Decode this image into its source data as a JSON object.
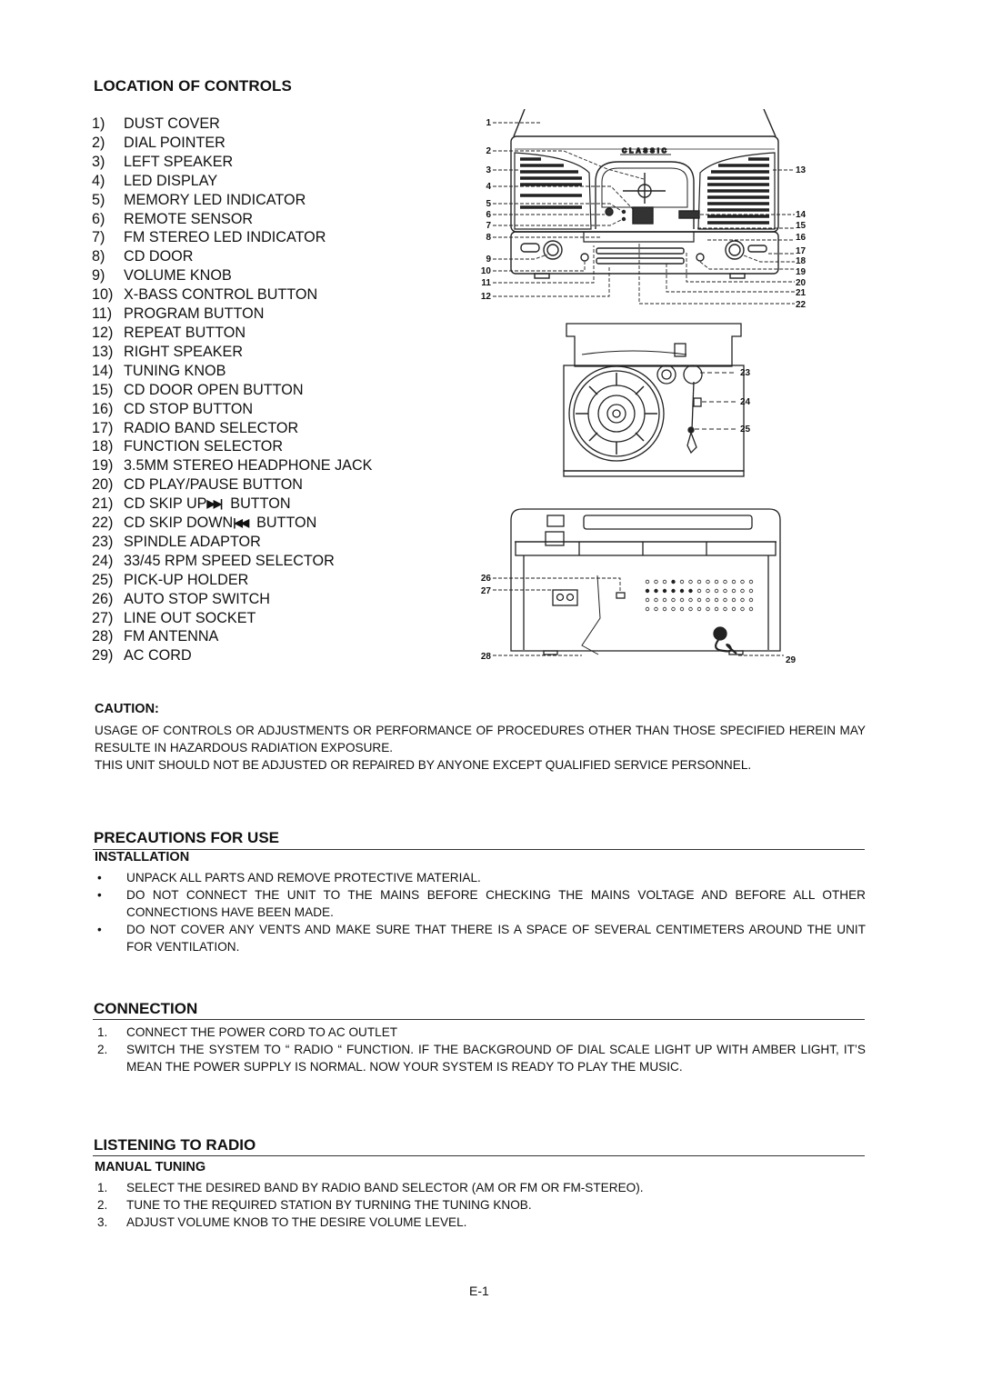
{
  "location_of_controls": {
    "title": "LOCATION OF CONTROLS",
    "items": [
      {
        "num": "1)",
        "label": "DUST COVER"
      },
      {
        "num": "2)",
        "label": "DIAL POINTER"
      },
      {
        "num": "3)",
        "label": "LEFT SPEAKER"
      },
      {
        "num": "4)",
        "label": "LED DISPLAY"
      },
      {
        "num": "5)",
        "label": "MEMORY LED INDICATOR"
      },
      {
        "num": "6)",
        "label": "REMOTE SENSOR"
      },
      {
        "num": "7)",
        "label": "FM STEREO LED INDICATOR"
      },
      {
        "num": "8)",
        "label": "CD DOOR"
      },
      {
        "num": "9)",
        "label": "VOLUME KNOB"
      },
      {
        "num": "10)",
        "label": "X-BASS CONTROL BUTTON"
      },
      {
        "num": "11)",
        "label": "PROGRAM BUTTON"
      },
      {
        "num": "12)",
        "label": "REPEAT BUTTON"
      },
      {
        "num": "13)",
        "label": "RIGHT SPEAKER"
      },
      {
        "num": "14)",
        "label": "TUNING KNOB"
      },
      {
        "num": "15)",
        "label": "CD DOOR OPEN BUTTON"
      },
      {
        "num": "16)",
        "label": "CD STOP BUTTON"
      },
      {
        "num": "17)",
        "label": "RADIO BAND SELECTOR"
      },
      {
        "num": "18)",
        "label": "FUNCTION SELECTOR"
      },
      {
        "num": "19)",
        "label": "3.5MM STEREO HEADPHONE JACK"
      },
      {
        "num": "20)",
        "label": "CD PLAY/PAUSE BUTTON"
      },
      {
        "num": "21)",
        "label": "CD SKIP UP",
        "glyph": "▶▶|",
        "suffix": "BUTTON"
      },
      {
        "num": "22)",
        "label": "CD SKIP DOWN",
        "glyph": "|◀◀",
        "suffix": "BUTTON"
      },
      {
        "num": "23)",
        "label": "SPINDLE ADAPTOR"
      },
      {
        "num": "24)",
        "label": "33/45 RPM SPEED SELECTOR"
      },
      {
        "num": "25)",
        "label": "PICK-UP HOLDER"
      },
      {
        "num": "26)",
        "label": "AUTO STOP SWITCH"
      },
      {
        "num": "27)",
        "label": "LINE OUT SOCKET"
      },
      {
        "num": "28)",
        "label": "FM ANTENNA"
      },
      {
        "num": "29)",
        "label": "AC CORD"
      }
    ]
  },
  "diagram": {
    "brand_text": "CLASSIC",
    "front_callouts_left": [
      "1",
      "2",
      "3",
      "4",
      "5",
      "6",
      "7",
      "8",
      "9",
      "10",
      "11",
      "12"
    ],
    "front_callouts_right": [
      "13",
      "14",
      "15",
      "16",
      "17",
      "18",
      "19",
      "20",
      "21",
      "22"
    ],
    "top_callouts": [
      "23",
      "24",
      "25"
    ],
    "rear_callouts": [
      "26",
      "27",
      "28",
      "29"
    ]
  },
  "caution": {
    "title": "CAUTION:",
    "paragraphs": [
      "USAGE OF CONTROLS OR ADJUSTMENTS OR PERFORMANCE OF PROCEDURES OTHER THAN THOSE SPECIFIED HEREIN MAY RESULTE IN HAZARDOUS RADIATION EXPOSURE.",
      "THIS UNIT SHOULD NOT BE ADJUSTED OR REPAIRED BY ANYONE EXCEPT QUALIFIED SERVICE PERSONNEL."
    ]
  },
  "precautions": {
    "title": "PRECAUTIONS FOR USE",
    "subtitle": "INSTALLATION",
    "bullet": "•",
    "items": [
      "UNPACK ALL PARTS AND REMOVE PROTECTIVE MATERIAL.",
      "DO NOT CONNECT THE UNIT TO THE MAINS BEFORE CHECKING THE MAINS VOLTAGE AND BEFORE ALL OTHER CONNECTIONS HAVE BEEN MADE.",
      "DO NOT COVER ANY VENTS AND MAKE SURE THAT THERE IS A SPACE OF SEVERAL CENTIMETERS AROUND THE UNIT FOR VENTILATION."
    ]
  },
  "connection": {
    "title": "CONNECTION",
    "items": [
      {
        "num": "1.",
        "text": "CONNECT THE POWER CORD TO AC OUTLET"
      },
      {
        "num": "2.",
        "text": "SWITCH THE SYSTEM TO “ RADIO “ FUNCTION. IF THE BACKGROUND OF DIAL SCALE LIGHT UP WITH AMBER LIGHT, IT’S MEAN THE POWER SUPPLY IS NORMAL. NOW YOUR SYSTEM IS READY TO PLAY THE MUSIC."
      }
    ]
  },
  "listening": {
    "title": "LISTENING TO RADIO",
    "subtitle": "MANUAL TUNING",
    "items": [
      {
        "num": "1.",
        "text": "SELECT THE DESIRED BAND BY RADIO BAND SELECTOR (AM OR FM OR FM-STEREO)."
      },
      {
        "num": "2.",
        "text": "TUNE TO THE REQUIRED STATION BY TURNING THE TUNING KNOB."
      },
      {
        "num": "3.",
        "text": "ADJUST VOLUME KNOB TO THE DESIRE VOLUME LEVEL."
      }
    ]
  },
  "page_number": "E-1"
}
